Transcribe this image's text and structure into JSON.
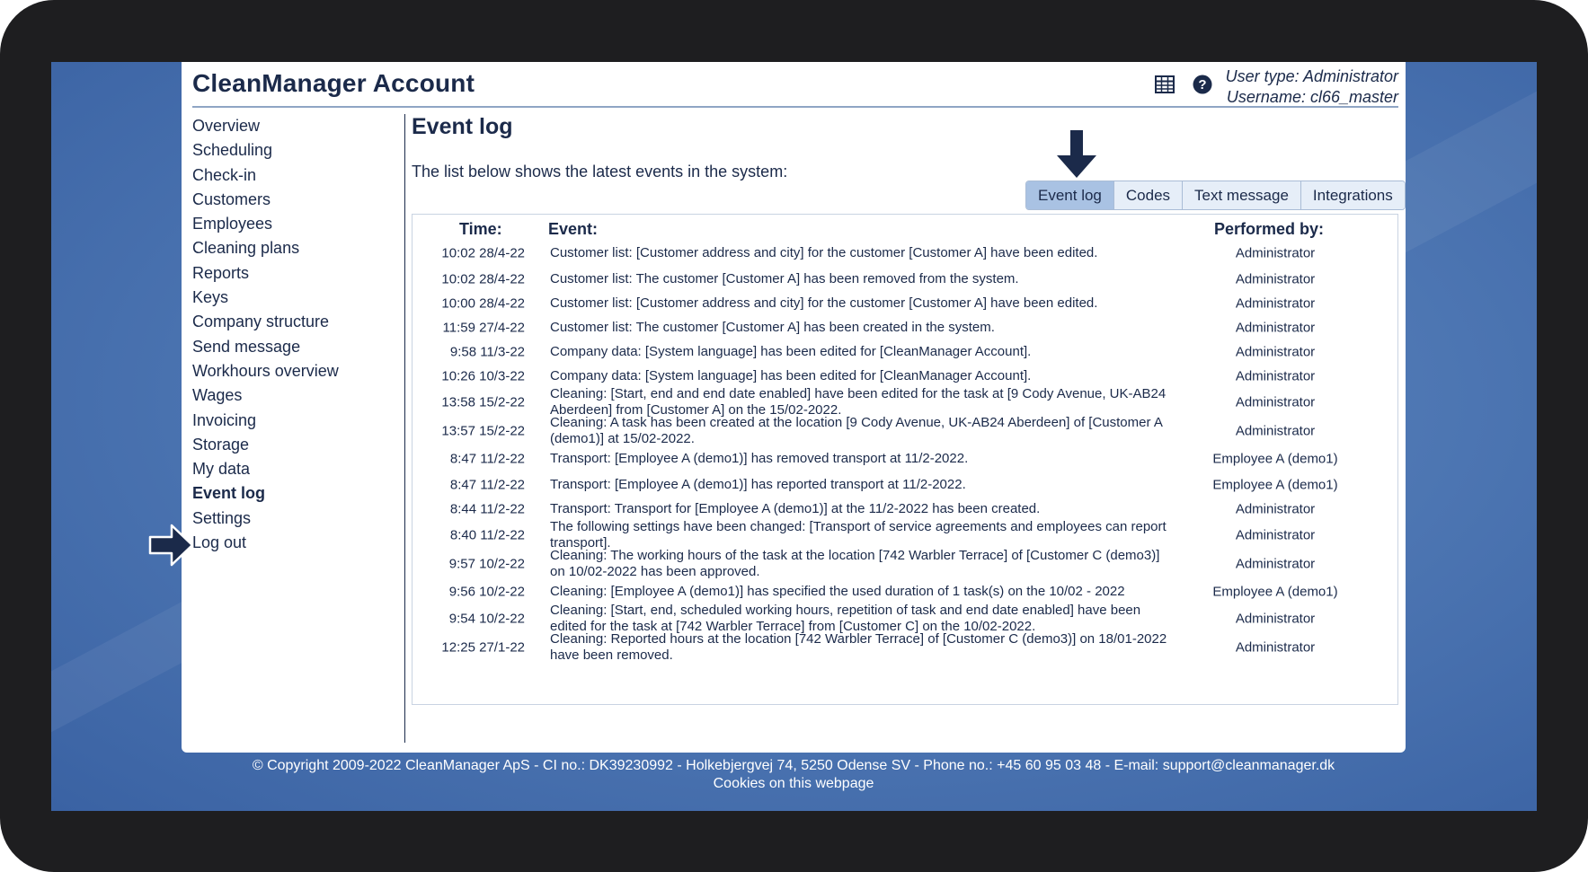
{
  "app": {
    "title": "CleanManager Account",
    "user_type": "User type: Administrator",
    "username": "Username: cl66_master"
  },
  "header_icons": [
    {
      "name": "table-grid-icon"
    },
    {
      "name": "help-icon"
    }
  ],
  "sidebar": {
    "items": [
      {
        "label": "Overview"
      },
      {
        "label": "Scheduling"
      },
      {
        "label": "Check-in"
      },
      {
        "label": "Customers"
      },
      {
        "label": "Employees"
      },
      {
        "label": "Cleaning plans"
      },
      {
        "label": "Reports"
      },
      {
        "label": "Keys"
      },
      {
        "label": "Company structure"
      },
      {
        "label": "Send message"
      },
      {
        "label": "Workhours overview"
      },
      {
        "label": "Wages"
      },
      {
        "label": "Invoicing"
      },
      {
        "label": "Storage"
      },
      {
        "label": "My data"
      },
      {
        "label": "Event log",
        "active": true
      },
      {
        "label": "Settings"
      },
      {
        "label": "Log out"
      }
    ]
  },
  "main": {
    "title": "Event log",
    "intro": "The list below shows the latest events in the system:",
    "tabs": [
      {
        "label": "Event log",
        "active": true
      },
      {
        "label": "Codes"
      },
      {
        "label": "Text message"
      },
      {
        "label": "Integrations"
      }
    ],
    "table": {
      "headers": {
        "time": "Time:",
        "event": "Event:",
        "by": "Performed by:"
      },
      "rows": [
        {
          "time": "10:02 28/4-22",
          "event": "Customer list: [Customer address and city] for the customer [Customer A] have been edited.",
          "by": "Administrator"
        },
        {
          "time": "10:02 28/4-22",
          "event": "Customer list: The customer [Customer A] has been removed from the system.",
          "by": "Administrator"
        },
        {
          "time": "10:00 28/4-22",
          "event": "Customer list: [Customer address and city] for the customer [Customer A] have been edited.",
          "by": "Administrator"
        },
        {
          "time": "11:59 27/4-22",
          "event": "Customer list: The customer [Customer A] has been created in the system.",
          "by": "Administrator"
        },
        {
          "time": "9:58 11/3-22",
          "event": "Company data: [System language] has been edited for [CleanManager Account].",
          "by": "Administrator"
        },
        {
          "time": "10:26 10/3-22",
          "event": "Company data: [System language] has been edited for [CleanManager Account].",
          "by": "Administrator"
        },
        {
          "time": "13:58 15/2-22",
          "event": "Cleaning: [Start, end and end date enabled] have been edited for the task at [9 Cody Avenue, UK-AB24 Aberdeen] from [Customer A] on the 15/02-2022.",
          "by": "Administrator"
        },
        {
          "time": "13:57 15/2-22",
          "event": "Cleaning: A task has been created at the location [9 Cody Avenue, UK-AB24 Aberdeen] of [Customer A (demo1)] at 15/02-2022.",
          "by": "Administrator"
        },
        {
          "time": "8:47 11/2-22",
          "event": "Transport: [Employee A (demo1)] has removed transport at 11/2-2022.",
          "by": "Employee A (demo1)"
        },
        {
          "time": "8:47 11/2-22",
          "event": "Transport: [Employee A (demo1)] has reported transport at 11/2-2022.",
          "by": "Employee A (demo1)"
        },
        {
          "time": "8:44 11/2-22",
          "event": "Transport: Transport for [Employee A (demo1)] at the 11/2-2022 has been created.",
          "by": "Administrator"
        },
        {
          "time": "8:40 11/2-22",
          "event": "The following settings have been changed: [Transport of service agreements and employees can report transport].",
          "by": "Administrator"
        },
        {
          "time": "9:57 10/2-22",
          "event": "Cleaning: The working hours of the task at the location [742 Warbler Terrace] of [Customer C (demo3)] on 10/02-2022 has been approved.",
          "by": "Administrator"
        },
        {
          "time": "9:56 10/2-22",
          "event": "Cleaning: [Employee A (demo1)] has specified the used duration of 1 task(s) on the 10/02 - 2022",
          "by": "Employee A (demo1)"
        },
        {
          "time": "9:54 10/2-22",
          "event": "Cleaning: [Start, end, scheduled working hours, repetition of task and end date enabled] have been edited for the task at [742 Warbler Terrace] from [Customer C] on the 10/02-2022.",
          "by": "Administrator"
        },
        {
          "time": "12:25 27/1-22",
          "event": "Cleaning: Reported hours at the location [742 Warbler Terrace] of [Customer C (demo3)] on 18/01-2022 have been removed.",
          "by": "Administrator"
        }
      ]
    }
  },
  "footer": {
    "copyright": "© Copyright 2009-2022 CleanManager ApS - CI no.: DK39230992 - Holkebjergvej 74, 5250 Odense SV - Phone no.: +45 60 95 03 48 - E-mail: support@cleanmanager.dk",
    "cookies": "Cookies on this webpage"
  },
  "colors": {
    "text": "#1b2a4a",
    "accent": "#a9c2e3",
    "background_blue": "#4f78b4",
    "frame": "#1e1e20"
  }
}
